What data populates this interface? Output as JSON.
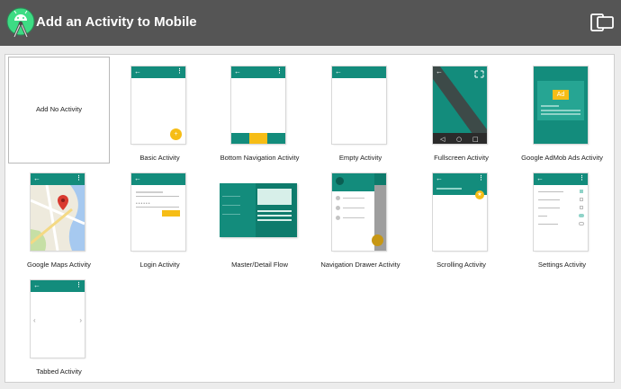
{
  "window": {
    "title": "Add an Activity to Mobile"
  },
  "icons": {
    "logo": "android-studio-logo-icon",
    "devices": "device-form-factor-icon"
  },
  "colors": {
    "teal": "#138c7c",
    "amber": "#f6bd16",
    "titlebar": "#555555"
  },
  "activities": [
    {
      "label": "Add No Activity",
      "selected": true
    },
    {
      "label": "Basic Activity"
    },
    {
      "label": "Bottom Navigation Activity"
    },
    {
      "label": "Empty Activity"
    },
    {
      "label": "Fullscreen Activity"
    },
    {
      "label": "Google AdMob Ads Activity",
      "badge": "Ad"
    },
    {
      "label": "Google Maps Activity"
    },
    {
      "label": "Login Activity"
    },
    {
      "label": "Master/Detail Flow"
    },
    {
      "label": "Navigation Drawer Activity"
    },
    {
      "label": "Scrolling Activity"
    },
    {
      "label": "Settings Activity"
    },
    {
      "label": "Tabbed Activity"
    }
  ]
}
